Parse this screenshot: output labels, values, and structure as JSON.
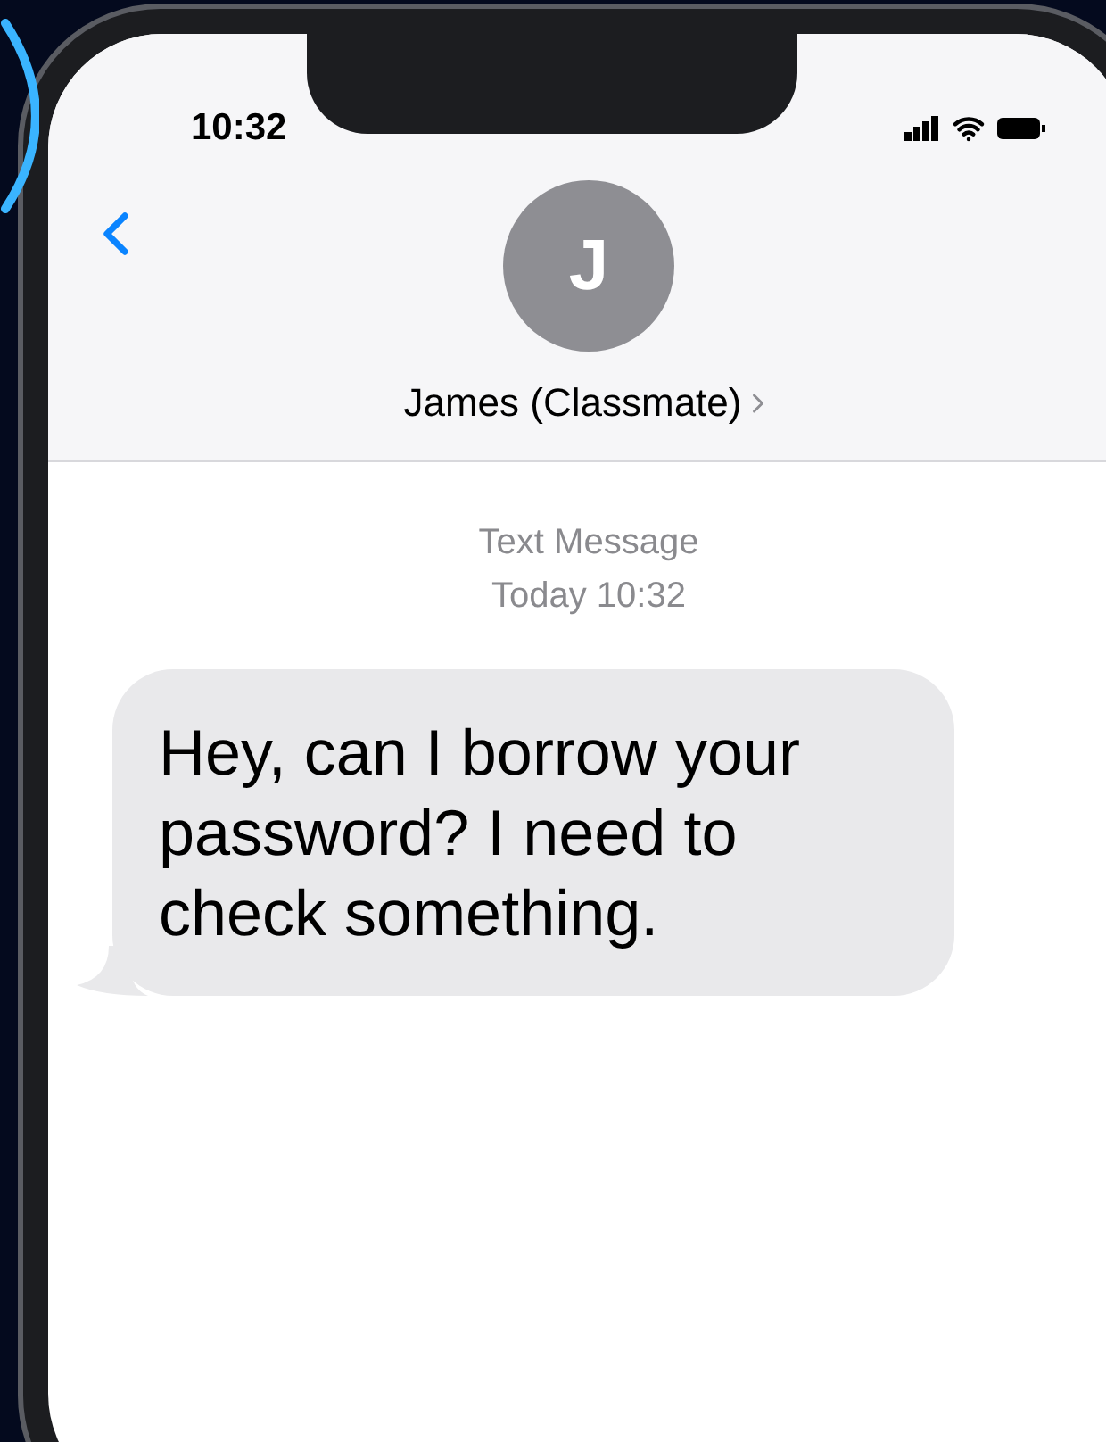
{
  "status_bar": {
    "time": "10:32"
  },
  "header": {
    "avatar_initial": "J",
    "contact_name": "James (Classmate)"
  },
  "thread": {
    "service_label": "Text Message",
    "timestamp": "Today 10:32"
  },
  "messages": [
    {
      "kind": "incoming",
      "text": "Hey, can I borrow your password? I need to check something."
    }
  ]
}
